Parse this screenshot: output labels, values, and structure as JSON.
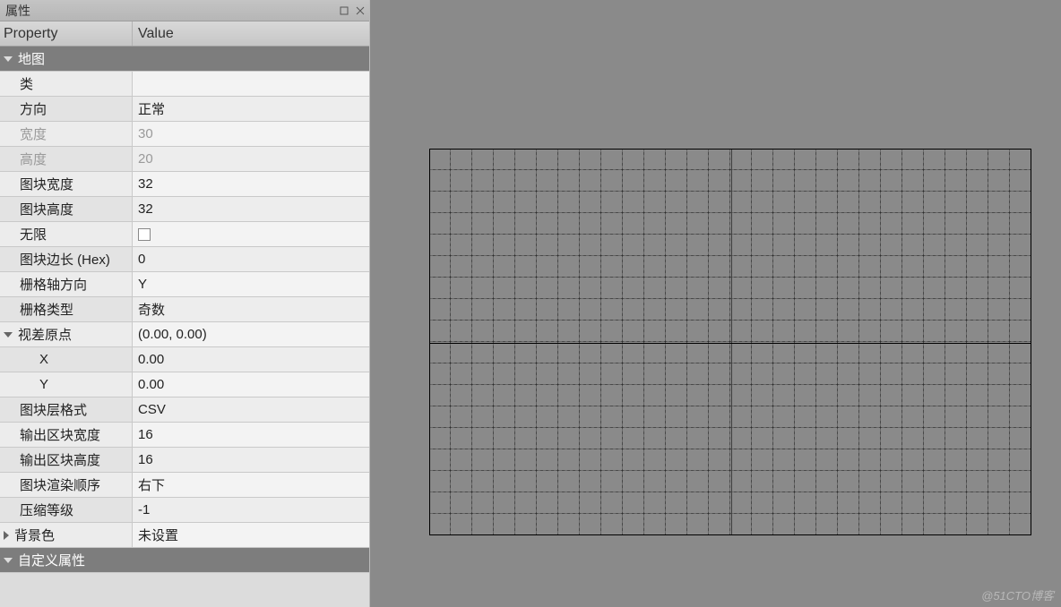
{
  "panel": {
    "title": "属性",
    "columns": {
      "property": "Property",
      "value": "Value"
    },
    "sections": {
      "map": {
        "label": "地图"
      },
      "custom": {
        "label": "自定义属性"
      }
    },
    "rows": {
      "class": {
        "label": "类",
        "value": ""
      },
      "orientation": {
        "label": "方向",
        "value": "正常"
      },
      "width": {
        "label": "宽度",
        "value": "30"
      },
      "height": {
        "label": "高度",
        "value": "20"
      },
      "tileWidth": {
        "label": "图块宽度",
        "value": "32"
      },
      "tileHeight": {
        "label": "图块高度",
        "value": "32"
      },
      "infinite": {
        "label": "无限",
        "value": false
      },
      "hexSide": {
        "label": "图块边长 (Hex)",
        "value": "0"
      },
      "staggerAxis": {
        "label": "栅格轴方向",
        "value": "Y"
      },
      "staggerIndex": {
        "label": "栅格类型",
        "value": "奇数"
      },
      "parallaxOrigin": {
        "label": "视差原点",
        "value": "(0.00, 0.00)"
      },
      "parallaxX": {
        "label": "X",
        "value": "0.00"
      },
      "parallaxY": {
        "label": "Y",
        "value": "0.00"
      },
      "layerFormat": {
        "label": "图块层格式",
        "value": "CSV"
      },
      "chunkW": {
        "label": "输出区块宽度",
        "value": "16"
      },
      "chunkH": {
        "label": "输出区块高度",
        "value": "16"
      },
      "renderOrder": {
        "label": "图块渲染顺序",
        "value": "右下"
      },
      "compression": {
        "label": "压缩等级",
        "value": "-1"
      },
      "bgColor": {
        "label": "背景色",
        "value": "未设置"
      }
    }
  },
  "watermark": "@51CTO博客"
}
